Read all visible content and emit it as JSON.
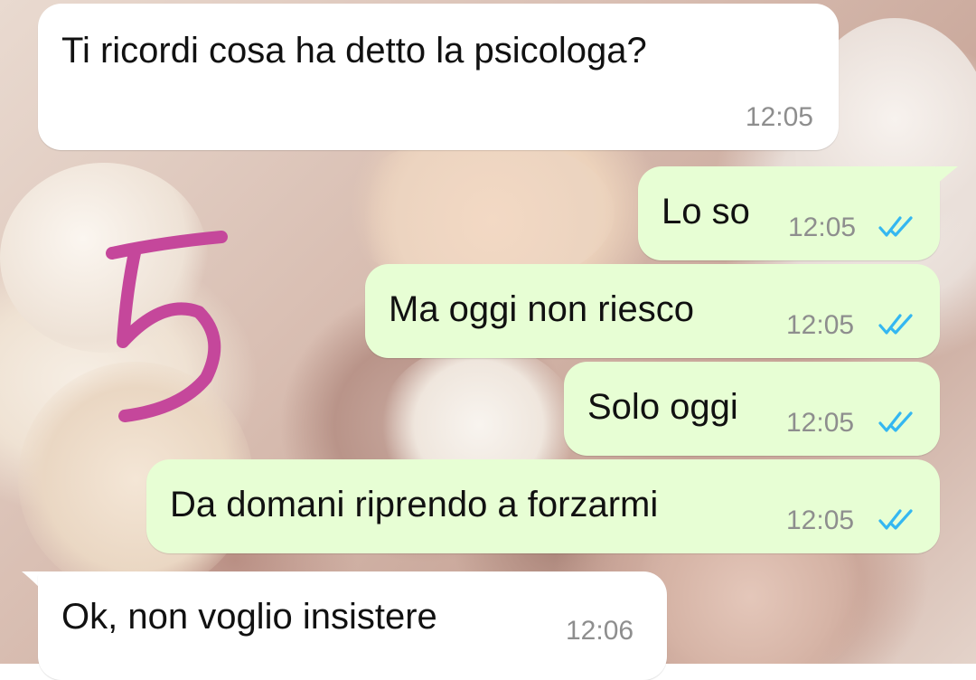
{
  "messages": [
    {
      "direction": "incoming",
      "text": "Ti ricordi cosa ha detto la psicologa?",
      "time": "12:05"
    },
    {
      "direction": "outgoing",
      "text": "Lo so",
      "time": "12:05",
      "status": "read"
    },
    {
      "direction": "outgoing",
      "text": "Ma oggi non riesco",
      "time": "12:05",
      "status": "read"
    },
    {
      "direction": "outgoing",
      "text": "Solo oggi",
      "time": "12:05",
      "status": "read"
    },
    {
      "direction": "outgoing",
      "text": "Da domani riprendo a forzarmi",
      "time": "12:05",
      "status": "read"
    },
    {
      "direction": "incoming",
      "text": "Ok, non voglio insistere",
      "time": "12:06"
    }
  ],
  "colors": {
    "incoming_bubble": "#ffffff",
    "outgoing_bubble": "#e7fed4",
    "read_ticks": "#34b7f1",
    "annotation": "#c5479b"
  },
  "annotation": {
    "icon": "handwritten-digit",
    "digit": "5"
  }
}
